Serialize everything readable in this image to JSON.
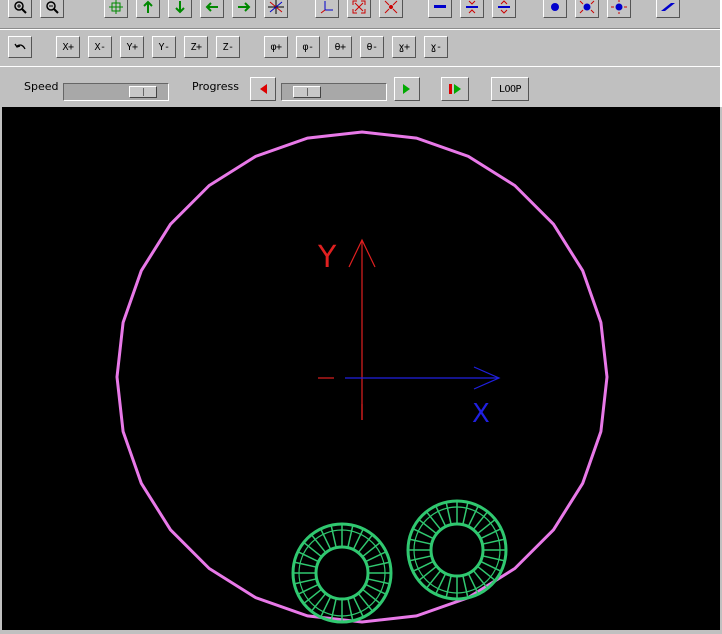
{
  "toolbar1": {
    "icons": [
      "zoom-in-icon",
      "zoom-out-icon",
      "pan-center-icon",
      "arrow-up-icon",
      "arrow-down-icon",
      "arrow-left-icon",
      "arrow-right-icon",
      "axes-center-icon",
      "axis-origin-icon",
      "expand-icon",
      "contract-icon",
      "line-horizontal-icon",
      "split-vertical-icon",
      "merge-vertical-icon",
      "dot-icon",
      "point-expand-icon",
      "point-contract-icon",
      "parallelogram-icon"
    ]
  },
  "toolbar2": {
    "undo_icon": "undo-icon",
    "x_plus": "X+",
    "x_minus": "X-",
    "y_plus": "Y+",
    "y_minus": "Y-",
    "z_plus": "Z+",
    "z_minus": "Z-",
    "phi_plus": "φ+",
    "phi_minus": "φ-",
    "theta_plus": "θ+",
    "theta_minus": "θ-",
    "gamma_plus": "ɣ+",
    "gamma_minus": "ɣ-"
  },
  "controls": {
    "speed_label": "Speed",
    "speed_value": 0.85,
    "progress_label": "Progress",
    "progress_value": 0.12,
    "loop_label": "LOOP"
  },
  "scene": {
    "axis_y_label": "Y",
    "axis_x_label": "X",
    "colors": {
      "circle": "#e879e8",
      "y_axis": "#e02020",
      "x_axis": "#2020e0",
      "bearing": "#30c870",
      "background": "#000000"
    }
  }
}
